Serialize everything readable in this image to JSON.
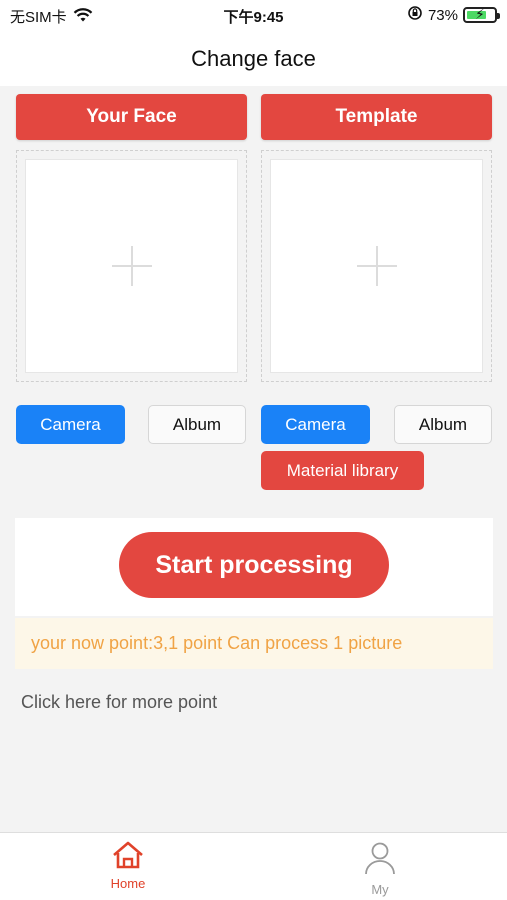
{
  "status_bar": {
    "carrier": "无SIM卡",
    "time": "下午9:45",
    "battery_percent": "73%",
    "battery_level": 0.73
  },
  "header": {
    "title": "Change face"
  },
  "panels": {
    "left": {
      "title": "Your Face",
      "camera_label": "Camera",
      "album_label": "Album"
    },
    "right": {
      "title": "Template",
      "camera_label": "Camera",
      "album_label": "Album",
      "library_label": "Material library"
    }
  },
  "process": {
    "start_label": "Start processing",
    "points_text": "your now point:3,1 point Can process 1 picture",
    "more_link": "Click here for more point"
  },
  "tab_bar": {
    "tabs": [
      {
        "label": "Home",
        "icon": "home-icon",
        "active": true
      },
      {
        "label": "My",
        "icon": "user-icon",
        "active": false
      }
    ]
  },
  "colors": {
    "accent_red": "#e34740",
    "accent_blue": "#1a82f7",
    "points_text": "#f0a345",
    "points_bg": "#fdf7e8",
    "tab_active": "#e0422a"
  }
}
